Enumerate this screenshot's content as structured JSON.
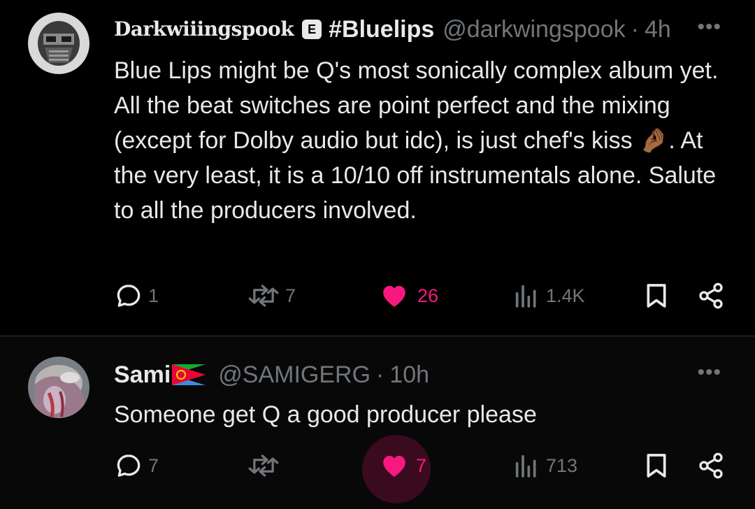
{
  "post1": {
    "display_name": "Darkwiiingspook",
    "badge": "E",
    "hashtag": "#Bluelips",
    "handle": "@darkwingspook",
    "dot": "·",
    "time": "4h",
    "more": "•••",
    "text": "Blue Lips might be Q's most sonically complex album yet. All the beat switches are point perfect and the mixing (except for Dolby audio but idc), is just chef's kiss 🤌🏾. At the very least, it is a 10/10 off instrumentals alone. Salute to all the producers involved.",
    "replies": "1",
    "reposts": "7",
    "likes": "26",
    "views": "1.4K",
    "liked": true
  },
  "post2": {
    "display_name": "Sami",
    "flag": "🇪🇷",
    "handle": "@SAMIGERG",
    "dot": "·",
    "time": "10h",
    "more": "•••",
    "text": "Someone get Q a good producer please",
    "replies": "7",
    "reposts": "",
    "likes": "7",
    "views": "713",
    "liked": true
  },
  "icons": {
    "reply": "reply-icon",
    "repost": "repost-icon",
    "like": "heart-icon",
    "views": "views-icon",
    "bookmark": "bookmark-icon",
    "share": "share-icon"
  },
  "colors": {
    "background": "#000000",
    "text": "#e7e9ea",
    "secondary": "#71767b",
    "like": "#f91880"
  }
}
